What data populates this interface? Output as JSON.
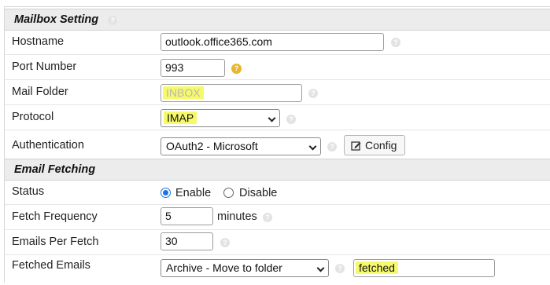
{
  "mailbox_section": {
    "title": "Mailbox Setting",
    "fields": {
      "hostname": {
        "label": "Hostname",
        "value": "outlook.office365.com"
      },
      "port": {
        "label": "Port Number",
        "value": "993"
      },
      "mail_folder": {
        "label": "Mail Folder",
        "placeholder": "INBOX"
      },
      "protocol": {
        "label": "Protocol",
        "selected": "IMAP"
      },
      "authentication": {
        "label": "Authentication",
        "selected": "OAuth2 - Microsoft",
        "config_label": "Config"
      }
    }
  },
  "fetching_section": {
    "title": "Email Fetching",
    "fields": {
      "status": {
        "label": "Status",
        "enable_label": "Enable",
        "disable_label": "Disable",
        "selected": "Enable"
      },
      "frequency": {
        "label": "Fetch Frequency",
        "value": "5",
        "unit": "minutes"
      },
      "per_fetch": {
        "label": "Emails Per Fetch",
        "value": "30"
      },
      "fetched": {
        "label": "Fetched Emails",
        "selected": "Archive - Move to folder",
        "folder_value": "fetched"
      }
    }
  },
  "colors": {
    "highlight": "#f6f96a",
    "help_icon_gold": "#e8b62b",
    "radio_accent": "#1a73e8",
    "section_bg": "#ececec"
  },
  "icons": {
    "help": "question-circle",
    "config": "edit-square"
  }
}
